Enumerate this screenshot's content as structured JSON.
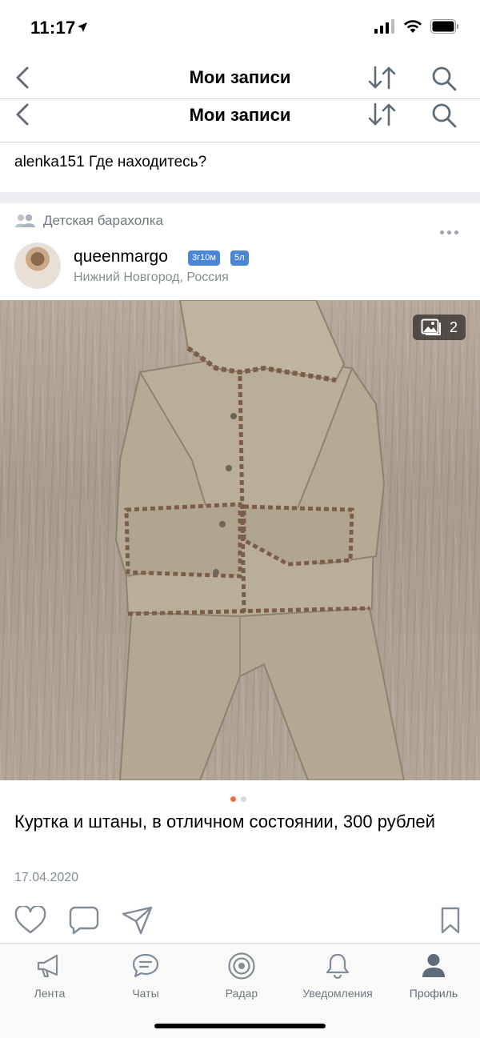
{
  "status": {
    "time": "11:17"
  },
  "navbar": {
    "title": "Мои записи"
  },
  "comment": {
    "author": "alenka151",
    "text": "Где находитесь?"
  },
  "post": {
    "group": "Детская барахолка",
    "author": "queenmargo",
    "badges": [
      "3г10м",
      "5л"
    ],
    "location": "Нижний Новгород, Россия",
    "photo_count": "2",
    "text": "Куртка и штаны, в отличном состоянии, 300 рублей",
    "date": "17.04.2020",
    "page_dots": {
      "active": "#e8703a",
      "inactive": "#d5d8dc"
    }
  },
  "tabbar": {
    "tabs": [
      {
        "label": "Лента",
        "icon": "megaphone-icon"
      },
      {
        "label": "Чаты",
        "icon": "chat-icon"
      },
      {
        "label": "Радар",
        "icon": "radar-icon"
      },
      {
        "label": "Уведомления",
        "icon": "bell-icon"
      },
      {
        "label": "Профиль",
        "icon": "profile-icon"
      }
    ],
    "active": "Профиль"
  },
  "colors": {
    "accent": "#2d81e0",
    "badge": "#4a86d8",
    "muted": "#818c99",
    "icon": "#5f6b78"
  }
}
